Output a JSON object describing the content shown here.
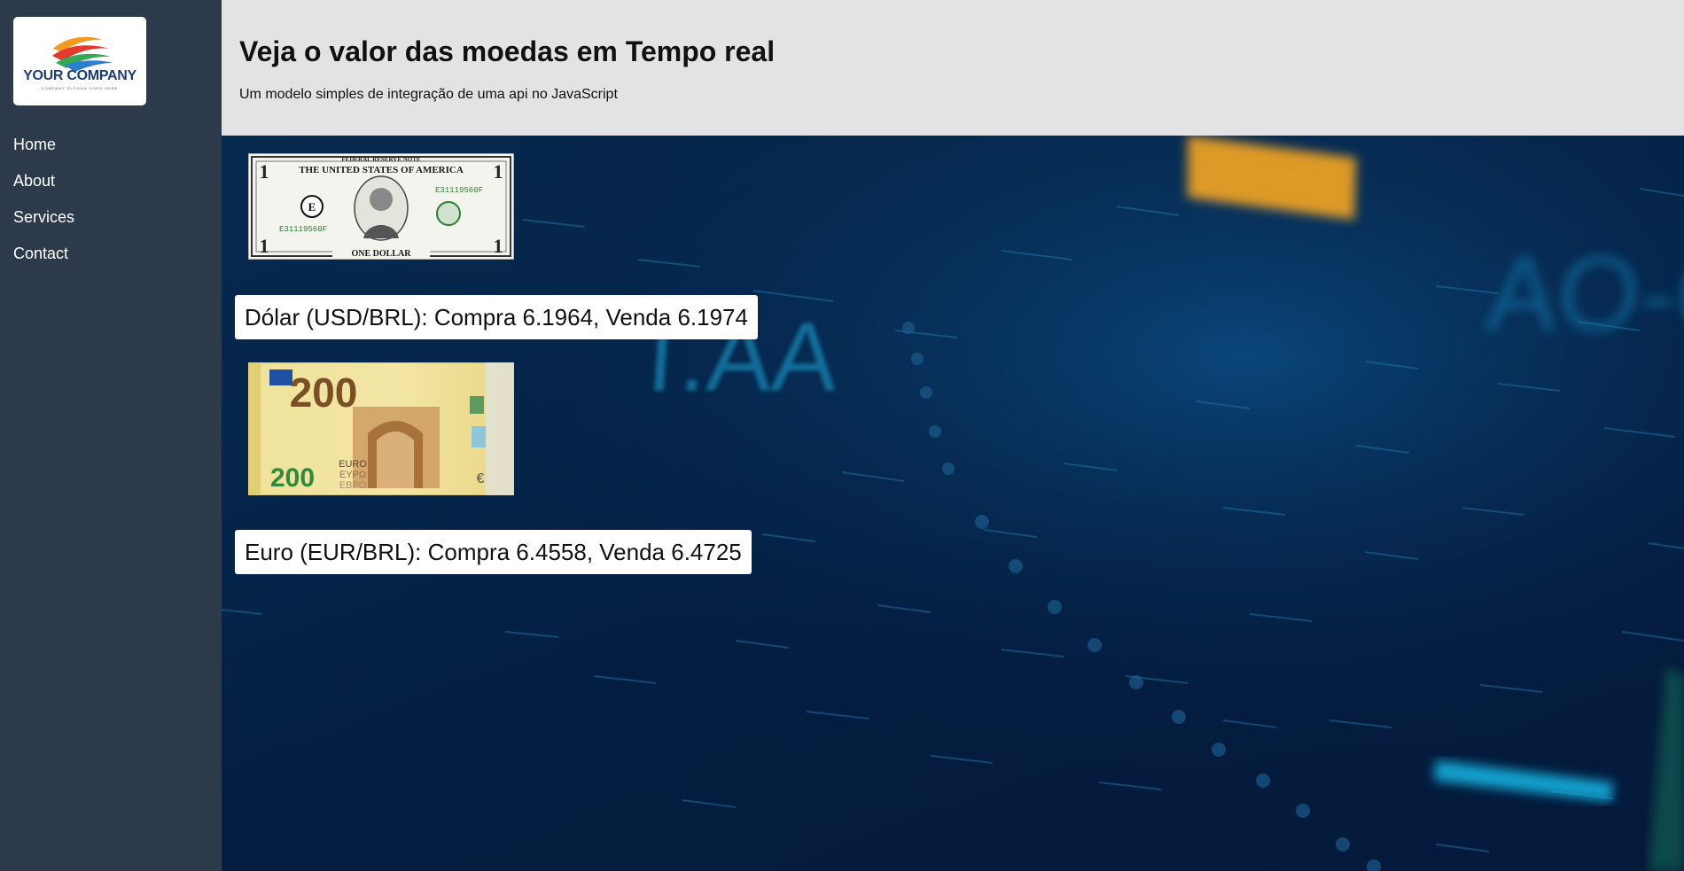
{
  "sidebar": {
    "logo": {
      "name": "YOUR COMPANY",
      "slogan": "COMPANY SLOGAN GOES HERE"
    },
    "nav": [
      {
        "label": "Home"
      },
      {
        "label": "About"
      },
      {
        "label": "Services"
      },
      {
        "label": "Contact"
      }
    ]
  },
  "header": {
    "title": "Veja o valor das moedas em Tempo real",
    "subtitle": "Um modelo simples de integração de uma api no JavaScript"
  },
  "main": {
    "background_text": [
      "T.AA",
      "AO-O"
    ],
    "dollar": {
      "header": "FEDERAL RESERVE NOTE",
      "country": "THE UNITED STATES OF AMERICA",
      "denomination": "ONE DOLLAR",
      "serial": "E31119560F",
      "seal": "E",
      "rate_text": "Dólar (USD/BRL): Compra 6.1964, Venda 6.1974"
    },
    "euro": {
      "value": "200",
      "label": "EURO",
      "label_greek": "ΕΥΡΩ",
      "label_cyrillic": "ЕВРО",
      "rate_text": "Euro (EUR/BRL): Compra 6.4558, Venda 6.4725"
    }
  },
  "colors": {
    "sidebar_bg": "#2c3a4c",
    "header_bg": "#e3e3e6",
    "main_bg": "#05244a",
    "accent_orange": "#f5a623",
    "accent_cyan": "#14b8e6"
  }
}
